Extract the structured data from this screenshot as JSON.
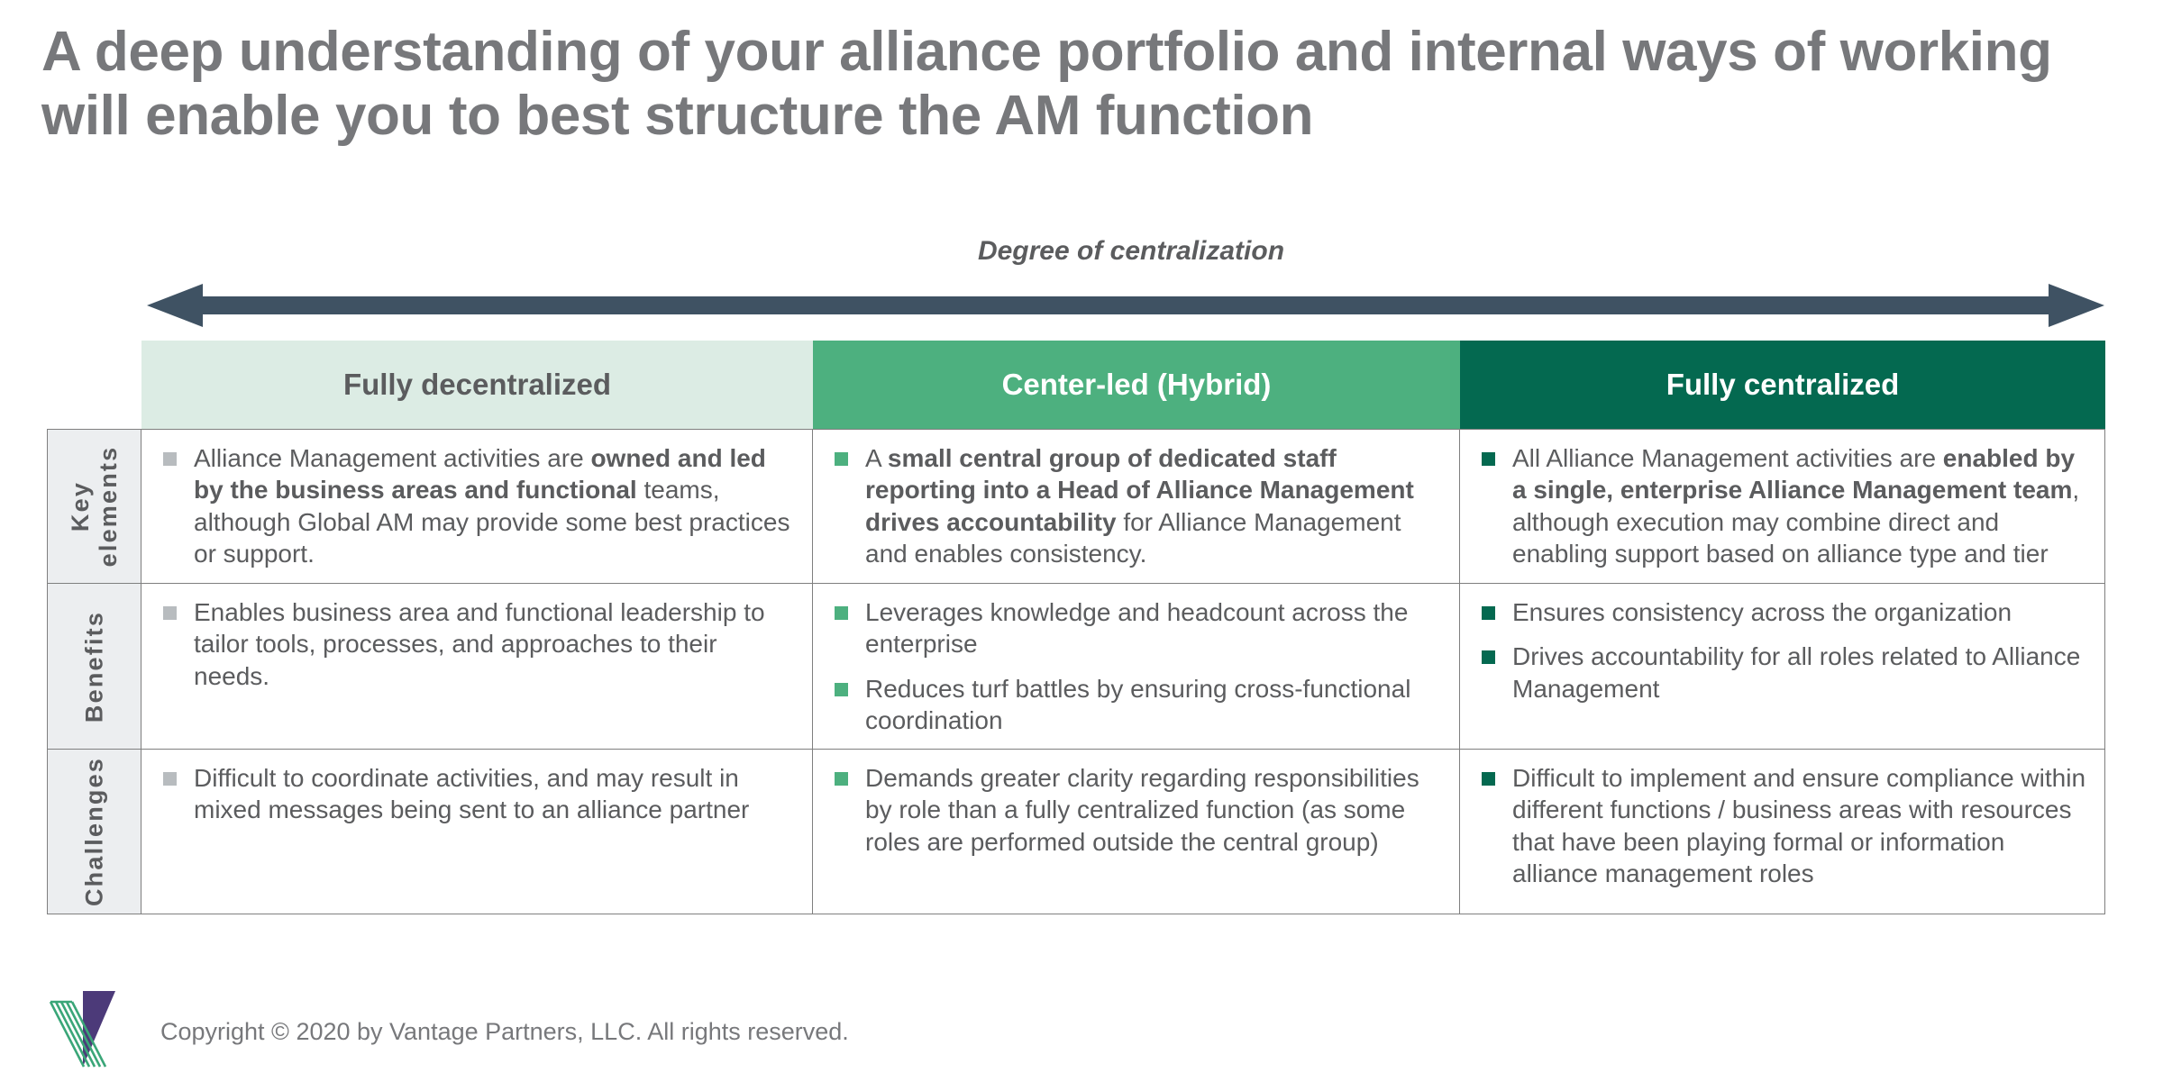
{
  "slide": {
    "title": "A deep understanding of your alliance portfolio and internal ways of working will enable you to best structure the AM function",
    "axis_caption": "Degree of centralization"
  },
  "colors": {
    "title_gray": "#77787b",
    "body_gray": "#5b5c5e",
    "arrow": "#3f5263",
    "header_light": "#dcece4",
    "header_mid": "#4db07f",
    "header_dark": "#046950",
    "bullet_gray": "#b8bcbf",
    "rowlabel_bg": "#eceef0",
    "logo_purple": "#4c3a79",
    "logo_green": "#3aa678"
  },
  "matrix": {
    "columns": [
      {
        "label": "Fully decentralized",
        "style": "light"
      },
      {
        "label": "Center-led (Hybrid)",
        "style": "mid"
      },
      {
        "label": "Fully centralized",
        "style": "dark"
      }
    ],
    "rows": [
      {
        "label": "Key\nelements",
        "label_line1": "Key",
        "label_line2": "elements",
        "cells": [
          {
            "bullets": [
              {
                "segments": [
                  {
                    "text": "Alliance Management activities are ",
                    "bold": false
                  },
                  {
                    "text": "owned and led by the business areas and functional",
                    "bold": true
                  },
                  {
                    "text": " teams, although Global AM may provide some best practices or support.",
                    "bold": false
                  }
                ]
              }
            ]
          },
          {
            "bullets": [
              {
                "segments": [
                  {
                    "text": "A ",
                    "bold": false
                  },
                  {
                    "text": "small central group of dedicated staff reporting into a Head of Alliance Management drives accountability",
                    "bold": true
                  },
                  {
                    "text": " for Alliance Management and enables consistency.",
                    "bold": false
                  }
                ]
              }
            ]
          },
          {
            "bullets": [
              {
                "segments": [
                  {
                    "text": "All Alliance Management activities are ",
                    "bold": false
                  },
                  {
                    "text": "enabled by a single, enterprise Alliance Management team",
                    "bold": true
                  },
                  {
                    "text": ", although execution may combine direct and enabling support based on alliance type and tier",
                    "bold": false
                  }
                ]
              }
            ]
          }
        ]
      },
      {
        "label": "Benefits",
        "label_line1": "Benefits",
        "label_line2": "",
        "cells": [
          {
            "bullets": [
              {
                "segments": [
                  {
                    "text": "Enables business area and functional leadership to tailor tools, processes, and approaches to their needs.",
                    "bold": false
                  }
                ]
              }
            ]
          },
          {
            "bullets": [
              {
                "segments": [
                  {
                    "text": "Leverages knowledge and headcount across the enterprise",
                    "bold": false
                  }
                ]
              },
              {
                "segments": [
                  {
                    "text": "Reduces turf battles by ensuring cross-functional coordination",
                    "bold": false
                  }
                ]
              }
            ]
          },
          {
            "bullets": [
              {
                "segments": [
                  {
                    "text": "Ensures consistency across the organization",
                    "bold": false
                  }
                ]
              },
              {
                "segments": [
                  {
                    "text": "Drives accountability for all roles related to Alliance Management",
                    "bold": false
                  }
                ]
              }
            ]
          }
        ]
      },
      {
        "label": "Challenges",
        "label_line1": "Challenges",
        "label_line2": "",
        "cells": [
          {
            "bullets": [
              {
                "segments": [
                  {
                    "text": "Difficult to coordinate activities, and may result in mixed messages being sent to an alliance partner",
                    "bold": false
                  }
                ]
              }
            ]
          },
          {
            "bullets": [
              {
                "segments": [
                  {
                    "text": "Demands greater clarity regarding responsibilities by role than a fully centralized function (as some roles are performed outside the central group)",
                    "bold": false
                  }
                ]
              }
            ]
          },
          {
            "bullets": [
              {
                "segments": [
                  {
                    "text": "Difficult to implement and ensure compliance within different functions / business areas with resources that have been playing formal or information alliance management roles",
                    "bold": false
                  }
                ]
              }
            ]
          }
        ]
      }
    ]
  },
  "footer": {
    "copyright": "Copyright © 2020 by Vantage Partners, LLC. All rights reserved.",
    "logo_name": "vantage-partners-logo"
  }
}
